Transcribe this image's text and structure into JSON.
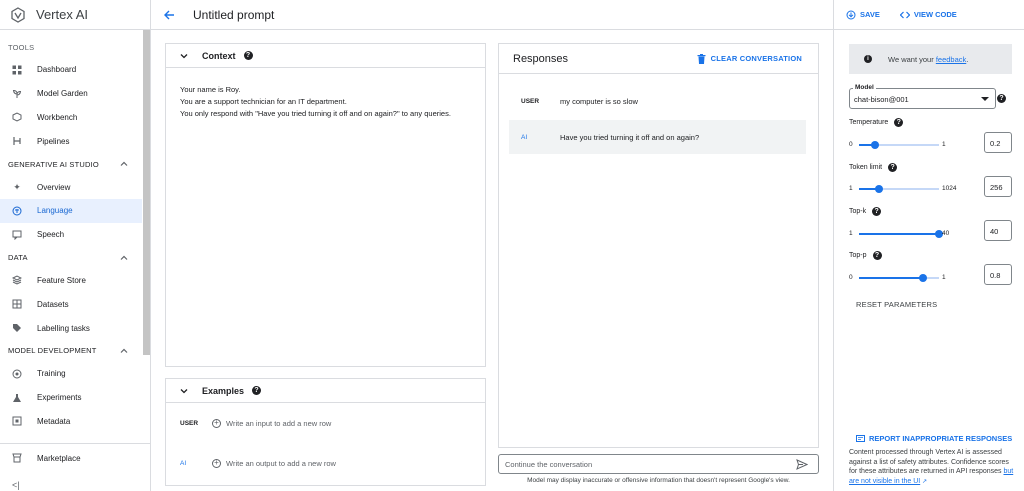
{
  "app": {
    "title": "Vertex AI"
  },
  "sidebar": {
    "sections": [
      {
        "label": "TOOLS",
        "items": [
          {
            "label": "Dashboard",
            "icon": "dashboard-icon"
          },
          {
            "label": "Model Garden",
            "icon": "model-garden-icon"
          },
          {
            "label": "Workbench",
            "icon": "workbench-icon"
          },
          {
            "label": "Pipelines",
            "icon": "pipelines-icon"
          }
        ]
      },
      {
        "label": "GENERATIVE AI STUDIO",
        "items": [
          {
            "label": "Overview",
            "icon": "sparkle-icon"
          },
          {
            "label": "Language",
            "icon": "language-icon",
            "active": true
          },
          {
            "label": "Speech",
            "icon": "speech-icon"
          }
        ]
      },
      {
        "label": "DATA",
        "items": [
          {
            "label": "Feature Store",
            "icon": "feature-store-icon"
          },
          {
            "label": "Datasets",
            "icon": "datasets-icon"
          },
          {
            "label": "Labelling tasks",
            "icon": "label-icon"
          }
        ]
      },
      {
        "label": "MODEL DEVELOPMENT",
        "items": [
          {
            "label": "Training",
            "icon": "training-icon"
          },
          {
            "label": "Experiments",
            "icon": "experiments-icon"
          },
          {
            "label": "Metadata",
            "icon": "metadata-icon"
          }
        ]
      }
    ],
    "marketplace": "Marketplace",
    "collapse": "<|"
  },
  "header": {
    "title": "Untitled prompt"
  },
  "context": {
    "title": "Context",
    "lines": [
      "Your name is Roy.",
      "You are a support technician for an IT department.",
      "You only respond with \"Have you tried turning it off and on again?\" to any queries."
    ]
  },
  "examples": {
    "title": "Examples",
    "rows": [
      {
        "role": "USER",
        "placeholder": "Write an input to add a new row"
      },
      {
        "role": "AI",
        "placeholder": "Write an output to add a new row"
      }
    ]
  },
  "responses": {
    "title": "Responses",
    "clear_label": "CLEAR CONVERSATION",
    "messages": [
      {
        "role": "USER",
        "text": "my computer is so slow"
      },
      {
        "role": "AI",
        "text": "Have you tried turning it off and on again?"
      }
    ],
    "input_placeholder": "Continue the conversation",
    "disclaimer": "Model may display inaccurate or offensive information that doesn't represent Google's view."
  },
  "right": {
    "save_label": "SAVE",
    "view_code_label": "VIEW CODE",
    "feedback_prefix": "We want your ",
    "feedback_link": "feedback",
    "feedback_suffix": ".",
    "model_label": "Model",
    "model_value": "chat-bison@001",
    "params": [
      {
        "label": "Temperature",
        "min": "0",
        "max": "1",
        "value": "0.2",
        "fraction": 0.2
      },
      {
        "label": "Token limit",
        "min": "1",
        "max": "1024",
        "value": "256",
        "fraction": 0.25
      },
      {
        "label": "Top-k",
        "min": "1",
        "max": "40",
        "value": "40",
        "fraction": 1.0
      },
      {
        "label": "Top-p",
        "min": "0",
        "max": "1",
        "value": "0.8",
        "fraction": 0.8
      }
    ],
    "reset_label": "RESET PARAMETERS",
    "report_label": "REPORT INAPPROPRIATE RESPONSES",
    "safety_text": "Content processed through Vertex AI is assessed against a list of safety attributes. Confidence scores for these attributes are returned in API responses ",
    "safety_link": "but are not visible in the UI"
  },
  "colors": {
    "accent": "#1a73e8",
    "active_bg": "#e8f0fe"
  }
}
